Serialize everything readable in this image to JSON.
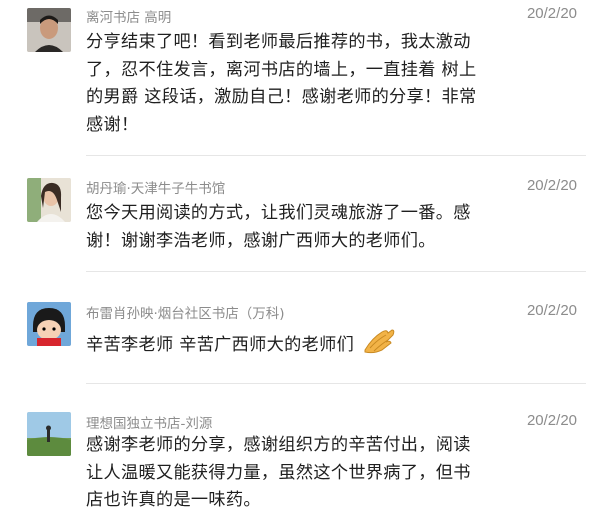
{
  "comments": [
    {
      "author": "离河书店 高明",
      "date": "20/2/20",
      "lines": [
        "分亨结束了吧！看到老师最后推荐的书，我太激动",
        "了，忍不住发言，离河书店的墙上，一直挂着 树上",
        "的男爵 这段话，激励自己！感谢老师的分享！非常",
        "感谢！"
      ],
      "avatar_icon": "man-portrait-avatar"
    },
    {
      "author": "胡丹瑜·天津牛子牛书馆",
      "date": "20/2/20",
      "lines": [
        "您今天用阅读的方式，让我们灵魂旅游了一番。感",
        "谢！谢谢李浩老师，感谢广西师大的老师们。"
      ],
      "avatar_icon": "woman-portrait-avatar"
    },
    {
      "author": "布雷肖孙映·烟台社区书店（万科)",
      "date": "20/2/20",
      "lines": [
        " 辛苦李老师 辛苦广西师大的老师们"
      ],
      "emoji": "clapping-hands-emoji",
      "avatar_icon": "cartoon-girl-avatar"
    },
    {
      "author": "理想国独立书店-刘源",
      "date": "20/2/20",
      "lines": [
        "感谢李老师的分享，感谢组织方的辛苦付出，阅读",
        "让人温暖又能获得力量，虽然这个世界病了，但书",
        "店也许真的是一味药。"
      ],
      "avatar_icon": "landscape-photo-avatar"
    }
  ]
}
